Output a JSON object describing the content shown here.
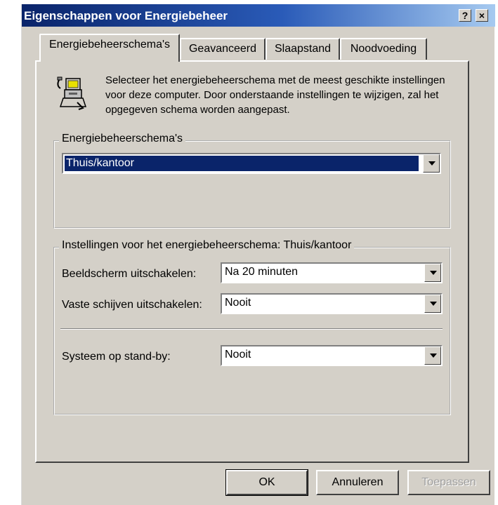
{
  "window": {
    "title": "Eigenschappen voor Energiebeheer",
    "help_button": "?",
    "close_button": "×"
  },
  "tabs": [
    {
      "label": "Energiebeheerschema's",
      "active": true
    },
    {
      "label": "Geavanceerd",
      "active": false
    },
    {
      "label": "Slaapstand",
      "active": false
    },
    {
      "label": "Noodvoeding",
      "active": false
    }
  ],
  "description": "Selecteer het energiebeheerschema met de meest geschikte instellingen voor deze computer. Door onderstaande instellingen te wijzigen, zal het opgegeven schema worden aangepast.",
  "schemes_group": {
    "legend": "Energiebeheerschema's",
    "selected_scheme": "Thuis/kantoor"
  },
  "settings_group": {
    "legend": "Instellingen voor het energiebeheerschema: Thuis/kantoor",
    "rows": [
      {
        "label": "Beeldscherm uitschakelen:",
        "value": "Na 20 minuten"
      },
      {
        "label": "Vaste schijven uitschakelen:",
        "value": "Nooit"
      },
      {
        "label": "Systeem op stand-by:",
        "value": "Nooit"
      }
    ]
  },
  "buttons": {
    "ok": "OK",
    "cancel": "Annuleren",
    "apply": "Toepassen"
  },
  "icons": {
    "power": "computer-power-plug-icon",
    "dropdown": "chevron-down-icon"
  }
}
